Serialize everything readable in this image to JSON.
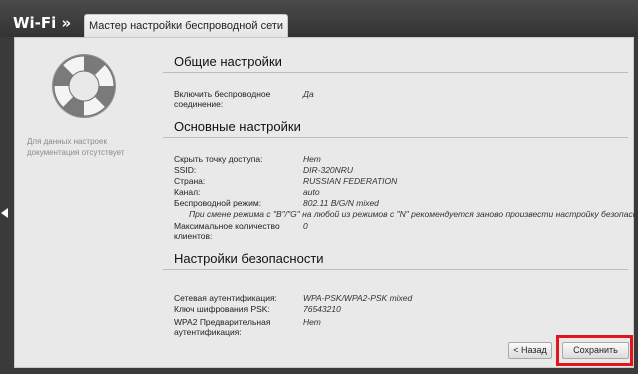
{
  "header": {
    "section": "Wi-Fi »",
    "tab": "Мастер настройки беспроводной сети"
  },
  "sidebar": {
    "note": "Для данных настроек документация отсутствует"
  },
  "general": {
    "title": "Общие настройки",
    "enable_label": "Включить беспроводное соединение:",
    "enable_value": "Да"
  },
  "basic": {
    "title": "Основные настройки",
    "rows": [
      {
        "label": "Скрыть точку доступа:",
        "value": "Нет"
      },
      {
        "label": "SSID:",
        "value": "DIR-320NRU"
      },
      {
        "label": "Страна:",
        "value": "RUSSIAN FEDERATION"
      },
      {
        "label": "Канал:",
        "value": "auto"
      },
      {
        "label": "Беспроводной режим:",
        "value": "802.11 B/G/N mixed"
      }
    ],
    "mode_note": "При смене режима с \"B\"/\"G\" на любой из режимов с \"N\" рекомендуется заново произвести настройку безопасности!",
    "max_clients_label": "Максимальное количество клиентов:",
    "max_clients_value": "0"
  },
  "security": {
    "title": "Настройки безопасности",
    "rows": [
      {
        "label": "Сетевая аутентификация:",
        "value": "WPA-PSK/WPA2-PSK mixed"
      },
      {
        "label": "Ключ шифрования PSK:",
        "value": "76543210"
      },
      {
        "label": "WPA2 Предварительная аутентификация:",
        "value": "Нет"
      }
    ]
  },
  "buttons": {
    "back": "< Назад",
    "save": "Сохранить"
  },
  "colors": {
    "highlight": "#e2141c",
    "panel": "#e9e9e9",
    "topbar": "#333333"
  }
}
